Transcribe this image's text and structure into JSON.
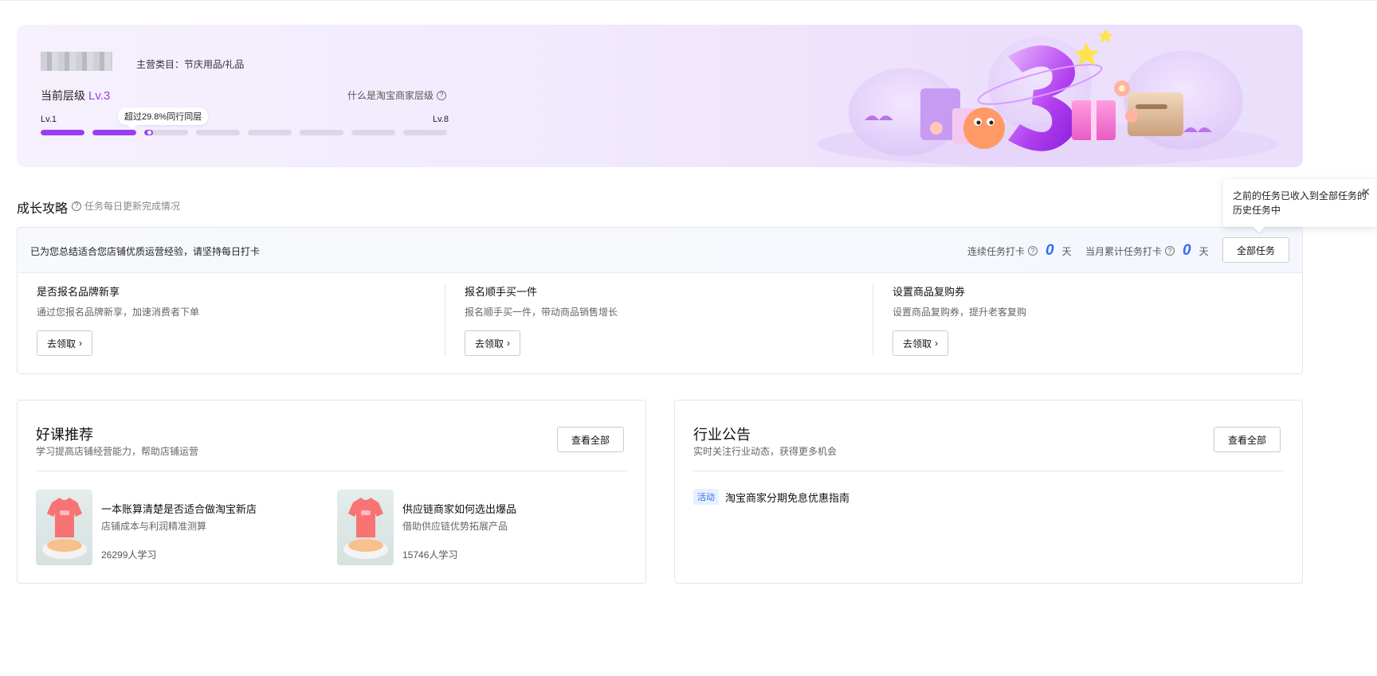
{
  "banner": {
    "category_label": "主营类目：节庆用品/礼品",
    "current_level_label": "当前层级",
    "current_level_value": "Lv.3",
    "what_level_link": "什么是淘宝商家层级",
    "lv_start": "Lv.1",
    "lv_end": "Lv.8",
    "peer_tooltip": "超过29.8%同行同层",
    "segments_total": 8,
    "segments_filled": 2,
    "current_segment_progress": 0.2,
    "accent_color": "#9a3df0"
  },
  "growth": {
    "title": "成长攻略",
    "subtitle": "任务每日更新完成情况",
    "tip": "已为您总结适合您店铺优质运营经验，请坚持每日打卡",
    "consecutive_label": "连续任务打卡",
    "consecutive_value": "0",
    "monthly_label": "当月累计任务打卡",
    "monthly_value": "0",
    "day_unit": "天",
    "all_tasks_button": "全部任务",
    "popover_text": "之前的任务已收入到全部任务的历史任务中",
    "tasks": [
      {
        "title": "是否报名品牌新享",
        "desc": "通过您报名品牌新享，加速消费者下单",
        "button": "去领取"
      },
      {
        "title": "报名顺手买一件",
        "desc": "报名顺手买一件，带动商品销售增长",
        "button": "去领取"
      },
      {
        "title": "设置商品复购券",
        "desc": "设置商品复购券，提升老客复购",
        "button": "去领取"
      }
    ]
  },
  "courses": {
    "title": "好课推荐",
    "subtitle": "学习提高店铺经营能力，帮助店铺运营",
    "view_all": "查看全部",
    "items": [
      {
        "title": "一本账算清楚是否适合做淘宝新店",
        "desc": "店铺成本与利润精准测算",
        "count": "26299人学习"
      },
      {
        "title": "供应链商家如何选出爆品",
        "desc": "借助供应链优势拓展产品",
        "count": "15746人学习"
      }
    ]
  },
  "notices": {
    "title": "行业公告",
    "subtitle": "实时关注行业动态，获得更多机会",
    "view_all": "查看全部",
    "items": [
      {
        "tag": "活动",
        "text": "淘宝商家分期免息优惠指南"
      }
    ]
  }
}
